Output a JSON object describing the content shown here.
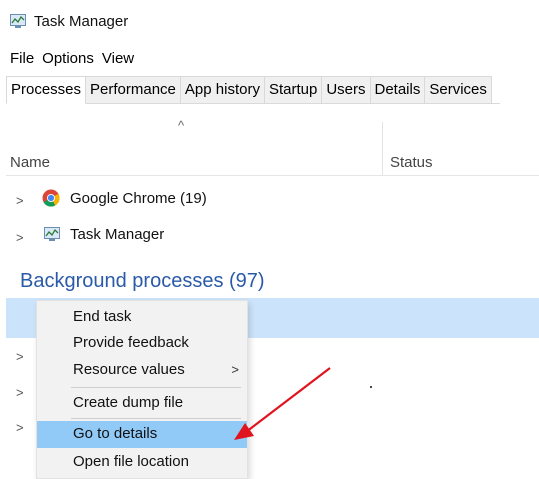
{
  "window": {
    "title": "Task Manager"
  },
  "menu": [
    "File",
    "Options",
    "View"
  ],
  "tabs": [
    "Processes",
    "Performance",
    "App history",
    "Startup",
    "Users",
    "Details",
    "Services"
  ],
  "columns": {
    "name": "Name",
    "status": "Status"
  },
  "apps": [
    {
      "label": "Google Chrome (19)",
      "icon": "chrome-icon"
    },
    {
      "label": "Task Manager",
      "icon": "task-manager-icon"
    }
  ],
  "section": {
    "title": "Background processes (97)"
  },
  "context_menu": {
    "items": [
      {
        "label": "End task"
      },
      {
        "label": "Provide feedback"
      },
      {
        "label": "Resource values",
        "submenu": true
      },
      {
        "label": "Create dump file"
      },
      {
        "label": "Go to details",
        "highlighted": true
      },
      {
        "label": "Open file location"
      }
    ]
  },
  "colors": {
    "accent_blue": "#2a5aa8",
    "selection": "#cce4fb",
    "menu_highlight": "#91c9f7",
    "arrow": "#e0141e"
  }
}
